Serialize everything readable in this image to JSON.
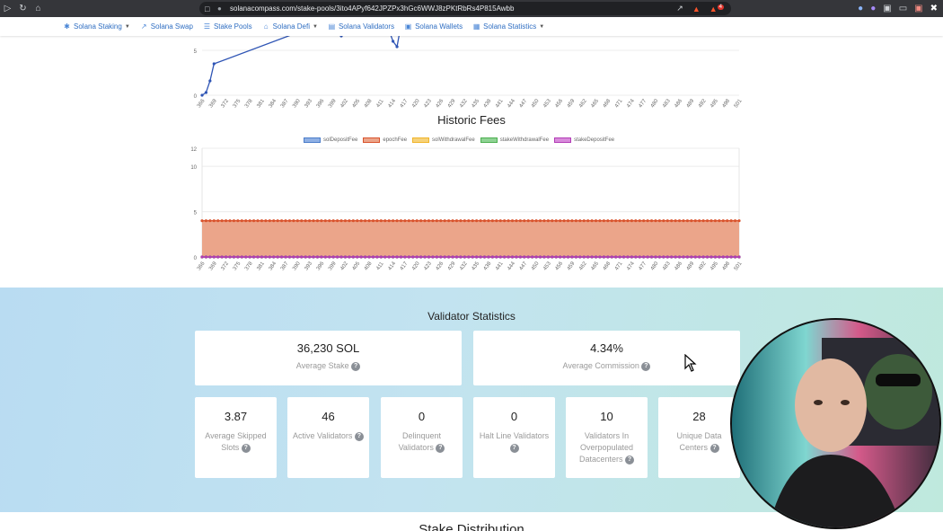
{
  "browser": {
    "url": "solanacompass.com/stake-pools/3ito4APyf642JPZPx3hGc6WWJ8zPKtRbRs4P815Awbb",
    "icons": [
      "back-icon",
      "reload-icon",
      "home-icon",
      "bookmark-icon",
      "lock-icon",
      "share-icon",
      "brave-shield-icon",
      "brave-rewards-icon"
    ],
    "rewards_badge": "4"
  },
  "site_nav": {
    "items": [
      {
        "label": "Solana Staking",
        "icon": "solana-staking-icon",
        "dropdown": true
      },
      {
        "label": "Solana Swap",
        "icon": "swap-chart-icon",
        "dropdown": false
      },
      {
        "label": "Stake Pools",
        "icon": "list-icon",
        "dropdown": false
      },
      {
        "label": "Solana Defi",
        "icon": "bank-icon",
        "dropdown": true
      },
      {
        "label": "Solana Validators",
        "icon": "server-icon",
        "dropdown": false
      },
      {
        "label": "Solana Wallets",
        "icon": "wallet-icon",
        "dropdown": false
      },
      {
        "label": "Solana Statistics",
        "icon": "stats-icon",
        "dropdown": true
      }
    ]
  },
  "chart_data": [
    {
      "type": "line",
      "title": "",
      "x_ticks": [
        "366",
        "369",
        "372",
        "375",
        "378",
        "381",
        "384",
        "387",
        "390",
        "393",
        "396",
        "399",
        "402",
        "405",
        "408",
        "411",
        "414",
        "417",
        "420",
        "423",
        "426",
        "429",
        "432",
        "435",
        "438",
        "441",
        "444",
        "447",
        "450",
        "453",
        "456",
        "459",
        "462",
        "465",
        "468",
        "471",
        "474",
        "477",
        "480",
        "483",
        "486",
        "489",
        "492",
        "495",
        "498",
        "501"
      ],
      "y_ticks": [
        "0",
        "5"
      ],
      "ylim": [
        0,
        8
      ],
      "series": [
        {
          "color": "#2f55b5",
          "x": [
            366,
            367,
            368,
            369,
            395,
            397,
            398,
            400,
            401,
            402,
            404,
            405,
            407,
            408,
            410,
            411,
            413,
            414,
            415,
            416
          ],
          "y": [
            0,
            0.3,
            1.6,
            3.5,
            7.8,
            7.6,
            7.2,
            7.8,
            6.6,
            7.5,
            7.8,
            7.3,
            7.7,
            7.9,
            7.5,
            7.8,
            7.2,
            6.0,
            5.4,
            7.8
          ]
        }
      ]
    },
    {
      "type": "area",
      "title": "Historic Fees",
      "legend": [
        "solDepositFee",
        "epochFee",
        "solWithdrawalFee",
        "stakeWithdrawalFee",
        "stakeDepositFee"
      ],
      "legend_position": "top",
      "x_ticks": [
        "366",
        "369",
        "372",
        "375",
        "378",
        "381",
        "384",
        "387",
        "390",
        "393",
        "396",
        "399",
        "402",
        "405",
        "408",
        "411",
        "414",
        "417",
        "420",
        "423",
        "426",
        "429",
        "432",
        "435",
        "438",
        "441",
        "444",
        "447",
        "450",
        "453",
        "456",
        "459",
        "462",
        "465",
        "468",
        "471",
        "474",
        "477",
        "480",
        "483",
        "486",
        "489",
        "492",
        "495",
        "498",
        "501"
      ],
      "y_ticks": [
        "0",
        "5",
        "10",
        "12"
      ],
      "ylim": [
        0,
        12
      ],
      "series": [
        {
          "name": "solDepositFee",
          "color": "#4a7cc9",
          "fill": "#8fb0e4",
          "values_constant": 0
        },
        {
          "name": "epochFee",
          "color": "#d9532c",
          "fill": "#eba58a",
          "values_constant": 4
        },
        {
          "name": "solWithdrawalFee",
          "color": "#f0b429",
          "fill": "#f6d27a",
          "values_constant": 0
        },
        {
          "name": "stakeWithdrawalFee",
          "color": "#4caf50",
          "fill": "#8fd394",
          "values_constant": 0
        },
        {
          "name": "stakeDepositFee",
          "color": "#b23cb5",
          "fill": "#d88bdb",
          "values_constant": 0
        }
      ]
    }
  ],
  "validator_stats": {
    "title": "Validator Statistics",
    "big": [
      {
        "value": "36,230 SOL",
        "label": "Average Stake"
      },
      {
        "value": "4.34%",
        "label": "Average Commission"
      }
    ],
    "small": [
      {
        "value": "3.87",
        "label": "Average Skipped Slots"
      },
      {
        "value": "46",
        "label": "Active Validators"
      },
      {
        "value": "0",
        "label": "Delinquent Validators"
      },
      {
        "value": "0",
        "label": "Halt Line Validators"
      },
      {
        "value": "10",
        "label": "Validators In Overpopulated Datacenters"
      },
      {
        "value": "28",
        "label": "Unique Data Centers"
      }
    ],
    "help_glyph": "?"
  },
  "next_section": {
    "title": "Stake Distribution"
  }
}
